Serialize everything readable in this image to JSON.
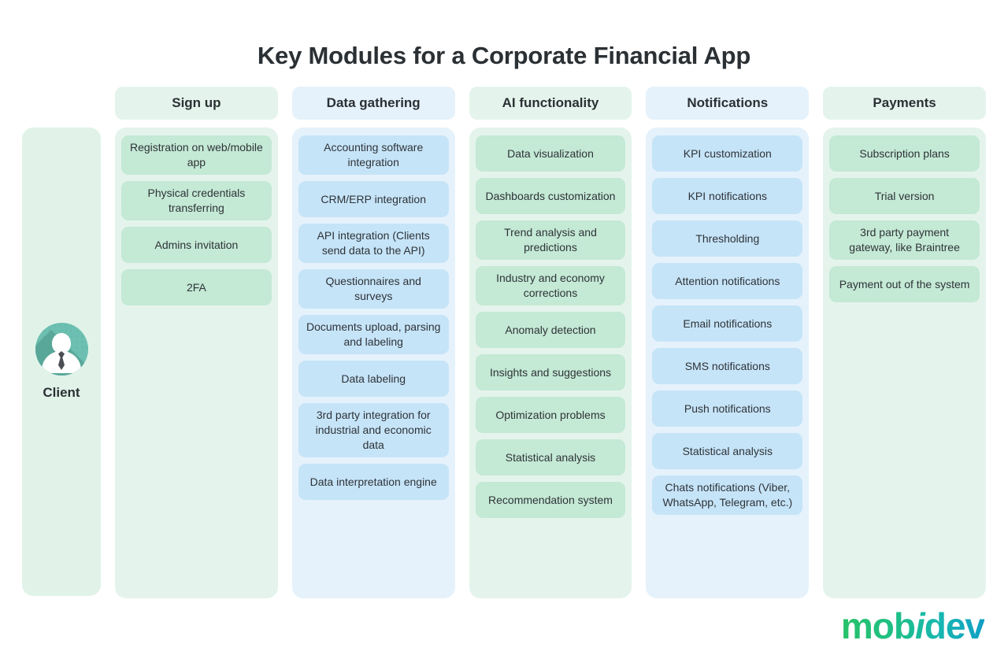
{
  "page": {
    "title": "Key Modules for a Corporate Financial App",
    "logo_part1": "mob",
    "logo_italic": "i",
    "logo_part2": "dev"
  },
  "colors": {
    "green_light": "#e4f4ec",
    "green_card": "#c4e9d5",
    "blue_light": "#e5f2fb",
    "blue_card": "#c6e4f8",
    "avatar_teal": "#6dc0b1",
    "text": "#2e3338",
    "logo_gradient_start": "#27c26a",
    "logo_gradient_end": "#119fc4"
  },
  "client": {
    "label": "Client",
    "icon": "user-avatar-icon"
  },
  "columns": [
    {
      "title": "Sign up",
      "theme": "green",
      "items": [
        "Registration on web/mobile app",
        "Physical credentials transferring",
        "Admins invitation",
        "2FA"
      ]
    },
    {
      "title": "Data gathering",
      "theme": "blue",
      "items": [
        "Accounting software integration",
        "CRM/ERP integration",
        "API integration (Clients send data to the API)",
        "Questionnaires and surveys",
        "Documents upload, parsing and labeling",
        "Data labeling",
        "3rd party integration for industrial and economic data",
        "Data interpretation engine"
      ]
    },
    {
      "title": "AI functionality",
      "theme": "green",
      "items": [
        "Data visualization",
        "Dashboards customization",
        "Trend analysis and predictions",
        "Industry and economy corrections",
        "Anomaly detection",
        "Insights and suggestions",
        "Optimization problems",
        "Statistical analysis",
        "Recommendation system"
      ]
    },
    {
      "title": "Notifications",
      "theme": "blue",
      "items": [
        "KPI customization",
        "KPI notifications",
        "Thresholding",
        "Attention notifications",
        "Email notifications",
        "SMS notifications",
        "Push notifications",
        "Statistical analysis",
        "Chats notifications (Viber, WhatsApp, Telegram, etc.)"
      ]
    },
    {
      "title": "Payments",
      "theme": "green",
      "items": [
        "Subscription plans",
        "Trial version",
        "3rd party payment gateway, like Braintree",
        "Payment out of the system"
      ]
    }
  ]
}
